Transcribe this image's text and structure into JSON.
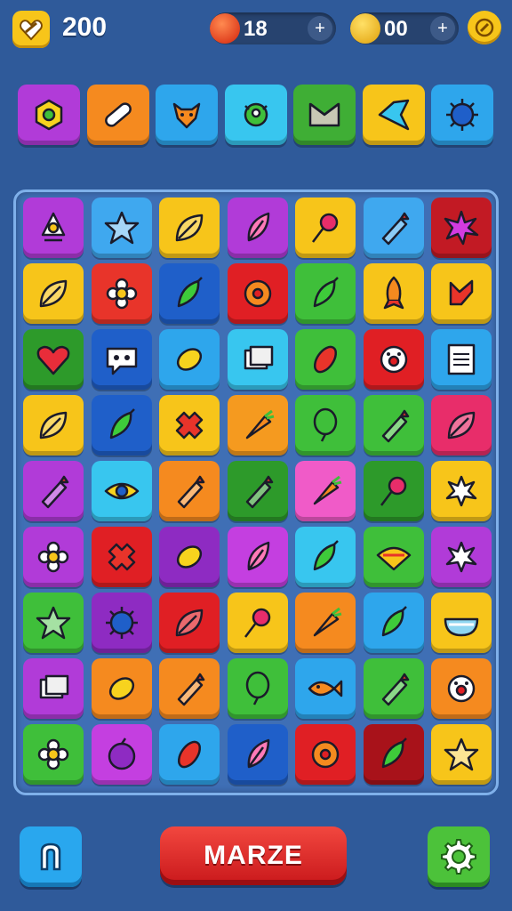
{
  "hud": {
    "score": "200",
    "lives": {
      "value": "18",
      "button": "+"
    },
    "stars": {
      "value": "00",
      "button": "+"
    }
  },
  "goals": [
    {
      "color": "#b13bd8",
      "icon": "gem-icon"
    },
    {
      "color": "#f58a1f",
      "icon": "bandage-icon"
    },
    {
      "color": "#2ea6ec",
      "icon": "fox-icon"
    },
    {
      "color": "#38c6ef",
      "icon": "creature-icon"
    },
    {
      "color": "#3fae35",
      "icon": "envelope-icon"
    },
    {
      "color": "#f7c51a",
      "icon": "bird-icon"
    },
    {
      "color": "#2ea6ec",
      "icon": "spiky-ball-icon"
    }
  ],
  "board": {
    "rows": [
      [
        {
          "color": "#b13bd8",
          "icon": "robot-icon"
        },
        {
          "color": "#3fa8ef",
          "icon": "star-icon"
        },
        {
          "color": "#f7c51a",
          "icon": "leaf-icon"
        },
        {
          "color": "#b13bd8",
          "icon": "feather-icon"
        },
        {
          "color": "#f7c51a",
          "icon": "lollipop-icon"
        },
        {
          "color": "#3fa8ef",
          "icon": "crayon-icon"
        },
        {
          "color": "#c21a24",
          "icon": "star-burst-icon"
        }
      ],
      [
        {
          "color": "#f7c51a",
          "icon": "leaf-icon"
        },
        {
          "color": "#e8342a",
          "icon": "flower-icon"
        },
        {
          "color": "#1f5fc9",
          "icon": "pepper-icon"
        },
        {
          "color": "#e01f24",
          "icon": "gear-flower-icon"
        },
        {
          "color": "#3fbf3a",
          "icon": "pepper-icon"
        },
        {
          "color": "#f7c51a",
          "icon": "rocket-icon"
        },
        {
          "color": "#f7c51a",
          "icon": "arrow-icon"
        }
      ],
      [
        {
          "color": "#2d9a2a",
          "icon": "heart-icon"
        },
        {
          "color": "#1f5fc9",
          "icon": "chat-bubble-icon"
        },
        {
          "color": "#2ea6ec",
          "icon": "lemon-icon"
        },
        {
          "color": "#38c6ef",
          "icon": "cards-icon"
        },
        {
          "color": "#3fbf3a",
          "icon": "seed-icon"
        },
        {
          "color": "#e01f24",
          "icon": "face-icon"
        },
        {
          "color": "#2ea6ec",
          "icon": "note-icon"
        }
      ],
      [
        {
          "color": "#f7c51a",
          "icon": "leaf-icon"
        },
        {
          "color": "#1f5fc9",
          "icon": "pepper-icon"
        },
        {
          "color": "#f7c51a",
          "icon": "cross-icon"
        },
        {
          "color": "#f59a1f",
          "icon": "carrot-icon"
        },
        {
          "color": "#3fbf3a",
          "icon": "balloon-icon"
        },
        {
          "color": "#3fbf3a",
          "icon": "crayon-icon"
        },
        {
          "color": "#e82d6a",
          "icon": "leaf-icon"
        }
      ],
      [
        {
          "color": "#b13bd8",
          "icon": "crayon-icon"
        },
        {
          "color": "#38c6ef",
          "icon": "eye-icon"
        },
        {
          "color": "#f58a1f",
          "icon": "crayon-icon"
        },
        {
          "color": "#2d9a2a",
          "icon": "crayon-icon"
        },
        {
          "color": "#f05bc8",
          "icon": "carrot-icon"
        },
        {
          "color": "#2d9a2a",
          "icon": "lollipop-icon"
        },
        {
          "color": "#f7c51a",
          "icon": "splash-icon"
        }
      ],
      [
        {
          "color": "#b13bd8",
          "icon": "flower-icon"
        },
        {
          "color": "#e01f24",
          "icon": "cross-icon"
        },
        {
          "color": "#8e2bc2",
          "icon": "lemon-icon"
        },
        {
          "color": "#c43fe0",
          "icon": "feather-icon"
        },
        {
          "color": "#38c6ef",
          "icon": "pepper-icon"
        },
        {
          "color": "#3fbf3a",
          "icon": "taco-icon"
        },
        {
          "color": "#b13bd8",
          "icon": "splash-icon"
        }
      ],
      [
        {
          "color": "#3fbf3a",
          "icon": "star-icon"
        },
        {
          "color": "#8e2bc2",
          "icon": "spiky-ball-icon"
        },
        {
          "color": "#e01f24",
          "icon": "leaf-icon"
        },
        {
          "color": "#f7c51a",
          "icon": "lollipop-icon"
        },
        {
          "color": "#f58a1f",
          "icon": "carrot-icon"
        },
        {
          "color": "#2ea6ec",
          "icon": "pepper-icon"
        },
        {
          "color": "#f7c51a",
          "icon": "bowl-icon"
        }
      ],
      [
        {
          "color": "#b13bd8",
          "icon": "cards-icon"
        },
        {
          "color": "#f58a1f",
          "icon": "lemon-icon"
        },
        {
          "color": "#f58a1f",
          "icon": "crayon-icon"
        },
        {
          "color": "#3fbf3a",
          "icon": "balloon-icon"
        },
        {
          "color": "#2ea6ec",
          "icon": "fish-icon"
        },
        {
          "color": "#3fbf3a",
          "icon": "crayon-icon"
        },
        {
          "color": "#f58a1f",
          "icon": "face-icon"
        }
      ],
      [
        {
          "color": "#3fbf3a",
          "icon": "flower-icon"
        },
        {
          "color": "#c43fe0",
          "icon": "plum-icon"
        },
        {
          "color": "#2ea6ec",
          "icon": "seed-icon"
        },
        {
          "color": "#1f5fc9",
          "icon": "feather-icon"
        },
        {
          "color": "#e01f24",
          "icon": "gear-flower-icon"
        },
        {
          "color": "#a8121a",
          "icon": "pepper-icon"
        },
        {
          "color": "#f7c51a",
          "icon": "star-icon"
        }
      ]
    ]
  },
  "buttons": {
    "main": "MARZE"
  }
}
